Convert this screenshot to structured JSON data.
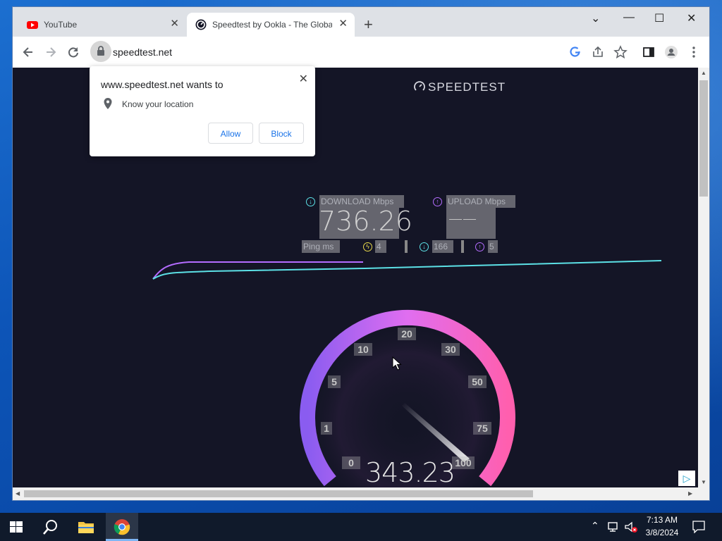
{
  "browser": {
    "tabs": [
      {
        "title": "YouTube",
        "favicon": "youtube-icon"
      },
      {
        "title": "Speedtest by Ookla - The Global Broadband Speed Test",
        "favicon": "speedtest-icon"
      }
    ],
    "close_glyph": "✕",
    "new_tab_glyph": "+",
    "window_controls": {
      "dropdown": "⌄",
      "minimize": "—",
      "maximize": "☐",
      "close": "✕"
    },
    "url": "speedtest.net"
  },
  "popup": {
    "heading": "www.speedtest.net wants to",
    "permission": "Know your location",
    "allow_label": "Allow",
    "block_label": "Block",
    "close_glyph": "✕"
  },
  "speedtest": {
    "logo_text": "SPEEDTEST",
    "download_label": "DOWNLOAD Mbps",
    "download_value": "736.26",
    "upload_label": "UPLOAD Mbps",
    "upload_value": "——",
    "ping_label": "Ping ms",
    "ping_value": "4",
    "download_ping": "166",
    "upload_ping": "5",
    "current_speed": "343.23",
    "gauge_labels": [
      "0",
      "1",
      "5",
      "10",
      "20",
      "30",
      "50",
      "75",
      "100"
    ],
    "colors": {
      "background": "#141526",
      "download": "#5ce1e6",
      "upload": "#b46cff",
      "gauge_start": "#8a5cf0",
      "gauge_end": "#ff5fae"
    }
  },
  "taskbar": {
    "time": "7:13 AM",
    "date": "3/8/2024"
  }
}
